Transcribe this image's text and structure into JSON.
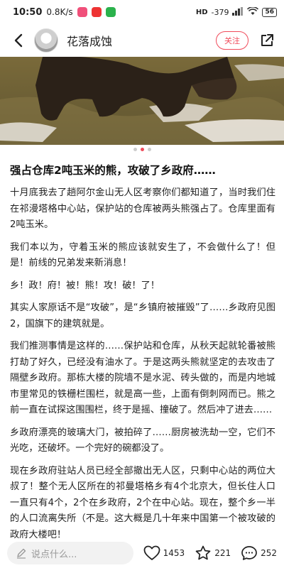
{
  "status_bar": {
    "time": "10:50",
    "network_speed": "0.8K/s",
    "signal_label": "-379",
    "battery": "56",
    "hd_label": "HD"
  },
  "header": {
    "author_name": "花落成蚀",
    "follow_label": "关注"
  },
  "carousel": {
    "total": 3,
    "active_index": 1
  },
  "post": {
    "title": "强占仓库2吨玉米的熊，攻破了乡政府……",
    "paragraphs": [
      "十月底我去了趟阿尔金山无人区考察你们都知道了，当时我们住在祁漫塔格中心站，保护站的仓库被两头熊强占了。仓库里面有2吨玉米。",
      "我们本以为，守着玉米的熊应该就安生了，不会做什么了！但是！前线的兄弟发来新消息！",
      "乡！政！府！被！熊！攻！破！了！",
      "其实人家原话不是“攻破”，是“乡镇府被摧毁”了……乡政府见图2，国旗下的建筑就是。",
      "我们推测事情是这样的……保护站和仓库，从秋天起就轮番被熊打劫了好久，已经没有油水了。于是这两头熊就坚定的去攻击了隔壁乡政府。那栋大楼的院墙不是水泥、砖头做的，而是内地城市里常见的铁栅栏围栏，就是高一些，上面有倒刺网而已。熊之前一直在试探这围围栏，终于是摇、撞破了。然后冲了进去……",
      "乡政府漂亮的玻璃大门，被拍碎了……厨房被洗劫一空，它们不光吃，还破坏。一个完好的碗都没了。",
      "现在乡政府驻站人员已经全部撤出无人区，只剩中心站的两位大叔了！整个无人区所在的祁曼塔格乡有4个北京大，但长住人口一直只有4个，2个在乡政府，2个在中心站。现在，整个乡一半的人口流离失所（不是。这大概是几十年来中国第一个被攻破的政府大楼吧！"
    ]
  },
  "bottom_bar": {
    "comment_placeholder": "说点什么...",
    "like_count": "1453",
    "favorite_count": "221",
    "comment_count": "252"
  },
  "colors": {
    "accent": "#f04a5a",
    "background": "#ffffff",
    "text": "#222222"
  },
  "icons": [
    "back-arrow-icon",
    "share-icon",
    "pencil-icon",
    "heart-icon",
    "star-icon",
    "chat-bubble-icon",
    "wifi-icon",
    "signal-icon"
  ]
}
